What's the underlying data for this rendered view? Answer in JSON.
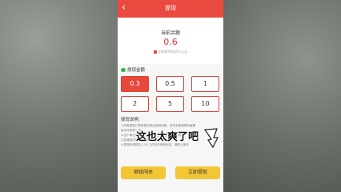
{
  "header": {
    "back_icon": "chevron-left-icon",
    "title": "提现"
  },
  "balance": {
    "label": "当前余额",
    "value": "0.6",
    "coin_note": "1000000金币=1元"
  },
  "withdraw": {
    "section_label": "提现金额",
    "amounts": [
      "0.3",
      "0.5",
      "1",
      "2",
      "5",
      "10"
    ],
    "selected_index": 0
  },
  "instructions": {
    "title": "提现说明:",
    "lines": [
      "1.所有提现订单审核完成后即刻到账，若未到账请联系客服",
      "   每天可提现一次",
      "2.由于每日提现人数较多，如遇排队请耐心等待",
      "3.如遇到问题可联系客服",
      "4.提现申请将在1-3个工作日内审核完成，请耐心等待"
    ]
  },
  "buttons": {
    "continue": "继续闯关",
    "withdraw_now": "立即提现"
  },
  "overlay_caption": "这也太爽了吧",
  "colors": {
    "accent": "#ea4a3f",
    "button": "#f3c636",
    "wechat": "#2db84a"
  }
}
